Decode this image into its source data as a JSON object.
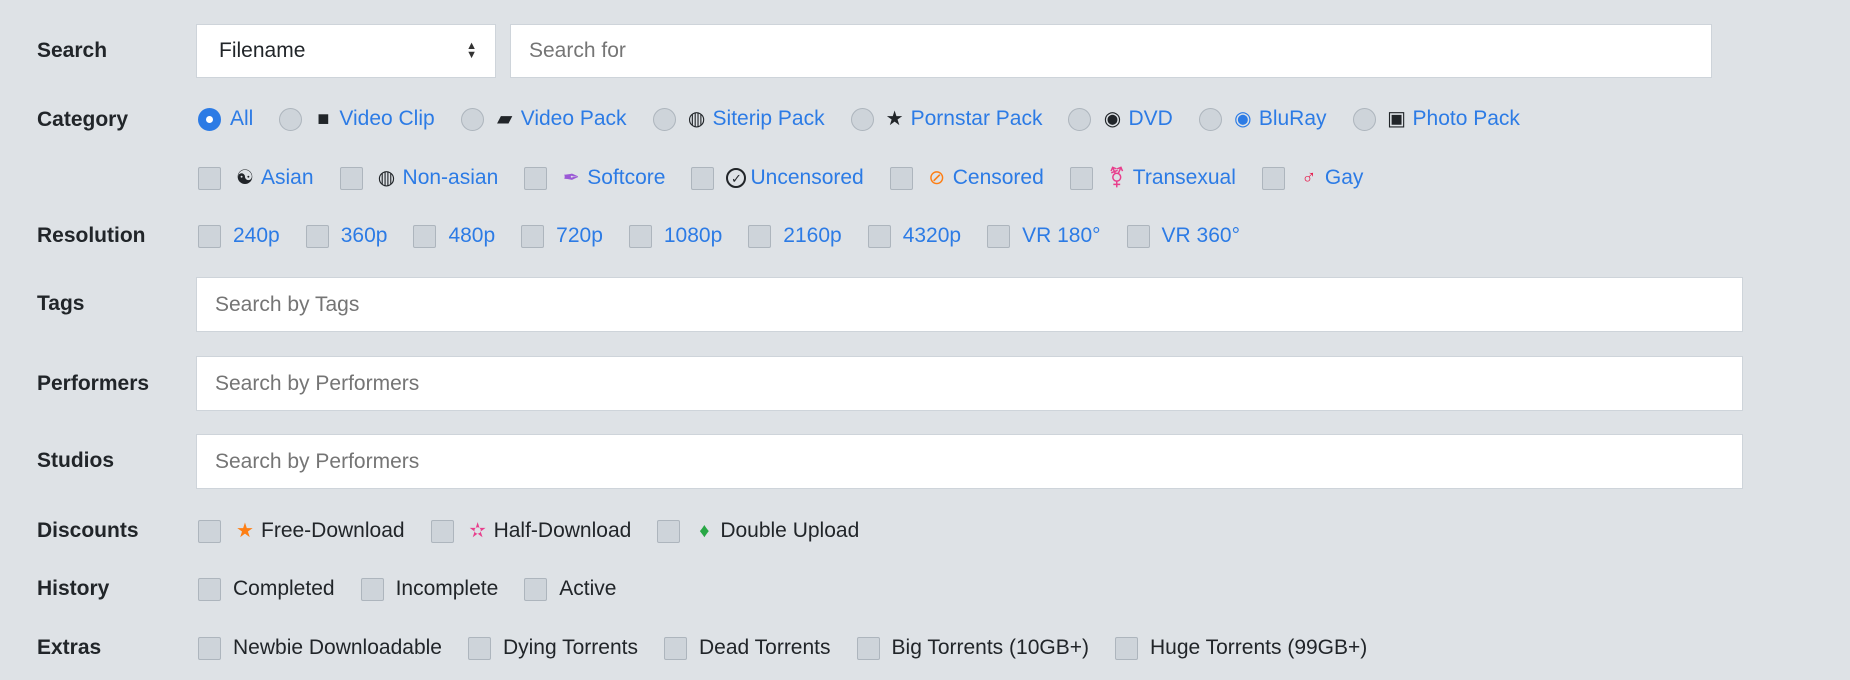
{
  "search": {
    "label": "Search",
    "select_value": "Filename",
    "placeholder": "Search for"
  },
  "category": {
    "label": "Category",
    "types": [
      {
        "label": "All",
        "icon": "none",
        "selected": true
      },
      {
        "label": "Video Clip",
        "icon": "video-camera-icon"
      },
      {
        "label": "Video Pack",
        "icon": "folder-open-icon"
      },
      {
        "label": "Siterip Pack",
        "icon": "globe-icon"
      },
      {
        "label": "Pornstar Pack",
        "icon": "star-icon"
      },
      {
        "label": "DVD",
        "icon": "disc-icon"
      },
      {
        "label": "BluRay",
        "icon": "bluray-disc-icon"
      },
      {
        "label": "Photo Pack",
        "icon": "images-icon"
      }
    ],
    "filters": [
      {
        "label": "Asian",
        "icon": "yin-yang-icon",
        "color": "#212529"
      },
      {
        "label": "Non-asian",
        "icon": "globe-icon",
        "color": "#212529"
      },
      {
        "label": "Softcore",
        "icon": "feather-icon",
        "color": "#9b59d6"
      },
      {
        "label": "Uncensored",
        "icon": "check-circle-icon",
        "color": "#212529"
      },
      {
        "label": "Censored",
        "icon": "ban-icon",
        "color": "#fd7e14"
      },
      {
        "label": "Transexual",
        "icon": "transgender-icon",
        "color": "#e83e8c"
      },
      {
        "label": "Gay",
        "icon": "mars-icon",
        "color": "#e6194b"
      }
    ]
  },
  "resolution": {
    "label": "Resolution",
    "items": [
      "240p",
      "360p",
      "480p",
      "720p",
      "1080p",
      "2160p",
      "4320p",
      "VR 180°",
      "VR 360°"
    ]
  },
  "tags": {
    "label": "Tags",
    "placeholder": "Search by Tags"
  },
  "performers": {
    "label": "Performers",
    "placeholder": "Search by Performers"
  },
  "studios": {
    "label": "Studios",
    "placeholder": "Search by Performers"
  },
  "discounts": {
    "label": "Discounts",
    "items": [
      {
        "label": "Free-Download",
        "icon": "star-icon",
        "color": "#fd7e14"
      },
      {
        "label": "Half-Download",
        "icon": "half-star-icon",
        "color": "#e83e8c"
      },
      {
        "label": "Double Upload",
        "icon": "gem-icon",
        "color": "#28a745"
      }
    ]
  },
  "history": {
    "label": "History",
    "items": [
      "Completed",
      "Incomplete",
      "Active"
    ]
  },
  "extras": {
    "label": "Extras",
    "items": [
      "Newbie Downloadable",
      "Dying Torrents",
      "Dead Torrents",
      "Big Torrents (10GB+)",
      "Huge Torrents (99GB+)"
    ]
  },
  "colors": {
    "accent": "#2c7be5",
    "background": "#dee2e6"
  }
}
